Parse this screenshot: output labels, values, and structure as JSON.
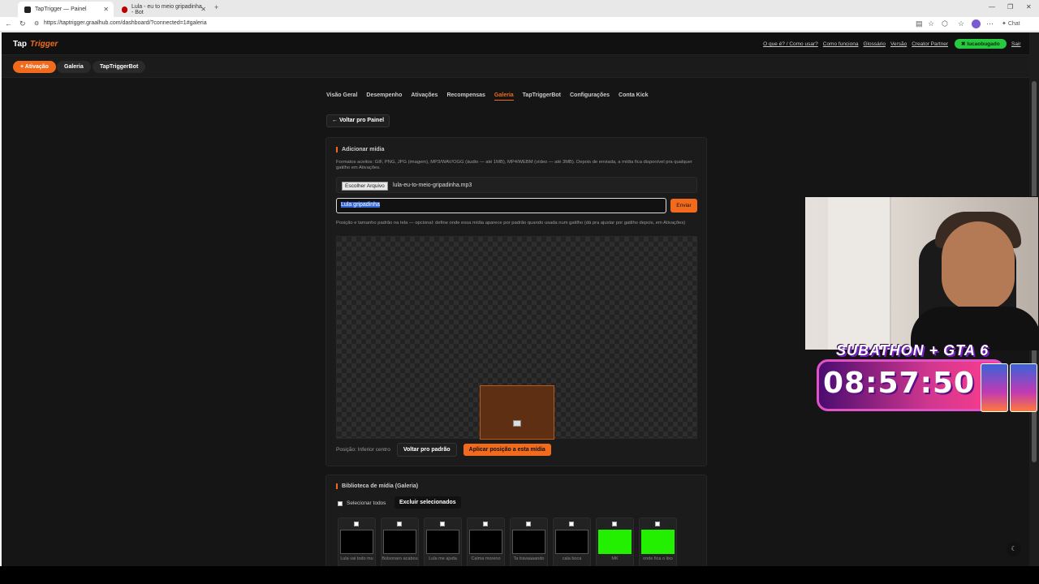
{
  "browser": {
    "tabs": [
      {
        "label": "TapTrigger — Painel",
        "active": true
      },
      {
        "label": "Lula - eu to meio gripadinha - Bot",
        "active": false
      }
    ],
    "url": "https://taptrigger.graalhub.com/dashboard/?connected=1#galeria",
    "chat_label": "Chat"
  },
  "header": {
    "logo_a": "Tap",
    "logo_b": "Trigger",
    "links": [
      "O que é? / Como usar?",
      "Como funciona",
      "Glossário",
      "Versão",
      "Creator Partner"
    ],
    "user": "lucaobugado",
    "logout": "Sair"
  },
  "subnav": {
    "activation": "+ Ativação",
    "gallery": "Galeria",
    "bot": "TapTriggerBot"
  },
  "tabs": [
    "Visão Geral",
    "Desempenho",
    "Ativações",
    "Recompensas",
    "Galeria",
    "TapTriggerBot",
    "Configurações",
    "Conta Kick"
  ],
  "active_tab": "Galeria",
  "back_button": "← Voltar pro Painel",
  "add_media": {
    "title": "Adicionar mídia",
    "formats_hint": "Formatos aceitos: GIF, PNG, JPG (imagem), MP3/WAV/OGG (áudio — até 1MB), MP4/WEBM (vídeo — até 3MB). Depois de enviada, a mídia fica disponível pra qualquer gatilho em Ativações.",
    "choose_file": "Escolher Arquivo",
    "file_name": "lula-eu-to-meio-gripadinha.mp3",
    "name_value": "Lula  gripadinha",
    "send": "Enviar",
    "position_hint": "Posição e tamanho padrão na tela — opcional: define onde essa mídia aparece por padrão quando usada num gatilho (dá pra ajustar por gatilho depois, em Ativações)",
    "position_label": "Posição: Inferior centro",
    "reset_button": "Voltar pro padrão",
    "apply_button": "Aplicar posição a esta mídia"
  },
  "library": {
    "title": "Biblioteca de mídia (Galeria)",
    "select_all": "Selecionar todos",
    "delete_selected": "Excluir selecionados",
    "items": [
      {
        "label": "Lula vai todo mu",
        "green": false
      },
      {
        "label": "Bolsonaro acabou",
        "green": false
      },
      {
        "label": "Lula me ajuda",
        "green": false
      },
      {
        "label": "Calma moreno",
        "green": false
      },
      {
        "label": "Ta travaaaando",
        "green": false
      },
      {
        "label": "cala boca",
        "green": false
      },
      {
        "label": "MK",
        "green": true
      },
      {
        "label": "onde fica o lixo",
        "green": true
      }
    ]
  },
  "overlay": {
    "subathon_title": "SUBATHON + GTA 6",
    "timer": "08:57:50"
  },
  "colors": {
    "accent": "#f26b1d",
    "user_pill": "#27c93f",
    "background": "#151515"
  }
}
